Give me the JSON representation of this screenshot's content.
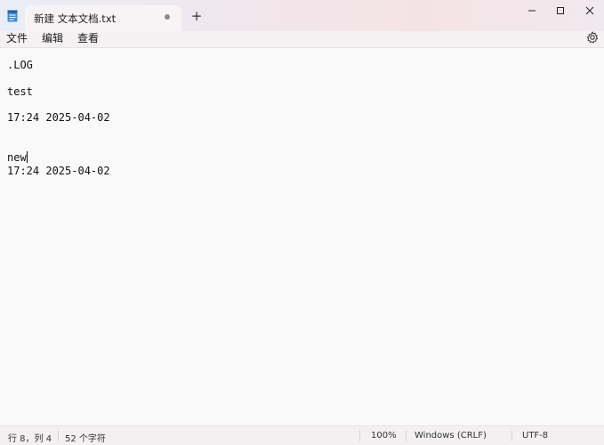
{
  "tab": {
    "title": "新建 文本文档.txt",
    "new_tab_label": "+"
  },
  "menu": {
    "items": [
      "文件",
      "编辑",
      "查看"
    ]
  },
  "editor": {
    "lines": [
      ".LOG",
      "test",
      "17:24 2025-04-02",
      "new",
      "17:24 2025-04-02"
    ]
  },
  "status": {
    "position": "行 8，列 4",
    "char_count": "52 个字符",
    "zoom": "100%",
    "line_ending": "Windows (CRLF)",
    "encoding": "UTF-8"
  },
  "icons": {
    "app": "notepad-icon",
    "settings": "gear-icon",
    "minimize": "minimize-icon",
    "maximize": "maximize-icon",
    "close": "close-icon",
    "unsaved": "unsaved-dot-icon"
  }
}
